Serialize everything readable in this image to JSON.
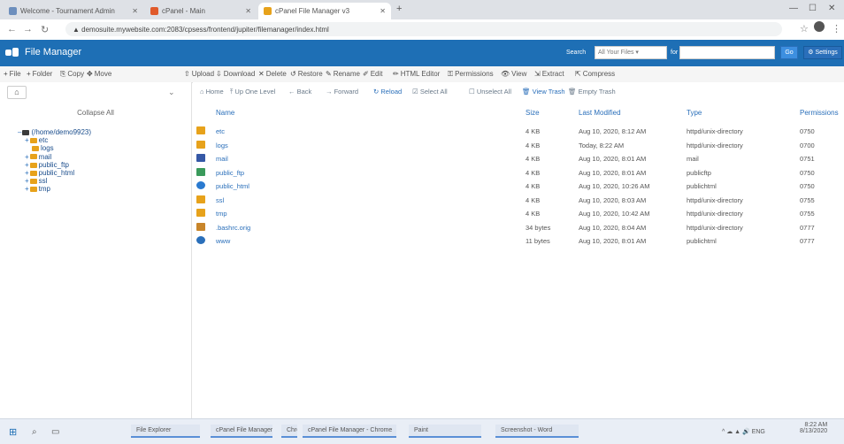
{
  "browser": {
    "tabs": [
      {
        "label": "Welcome - Tournament Admin",
        "color": "#6d8fbd"
      },
      {
        "label": "cPanel - Main",
        "color": "#e05a2b"
      },
      {
        "label": "cPanel File Manager v3",
        "color": "#e7a21b"
      }
    ],
    "new_tab": "+",
    "window_controls": {
      "minimize": "—",
      "maximize": "☐",
      "close": "✕"
    },
    "nav": {
      "back": "←",
      "forward": "→",
      "reload": "↻"
    },
    "url": "▲ demosuite.mywebsite.com:2083/cpsess/frontend/jupiter/filemanager/index.html",
    "star": "☆",
    "menu": "⋮"
  },
  "app": {
    "title": "File Manager",
    "logo_icon": "cpanel-logo-icon",
    "search_label": "Search",
    "search_scope": "All Your Files",
    "search_for_label": "for",
    "search_input": "",
    "go": "Go",
    "settings": "⚙ Settings"
  },
  "toolbar1": {
    "items": [
      {
        "icon": "+",
        "label": "File"
      },
      {
        "icon": "+",
        "label": "Folder"
      },
      {
        "icon": "⎘",
        "label": "Copy"
      },
      {
        "icon": "✥",
        "label": "Move"
      },
      {
        "icon": "⇧",
        "label": "Upload"
      },
      {
        "icon": "⇩",
        "label": "Download"
      },
      {
        "icon": "✕",
        "label": "Delete"
      },
      {
        "icon": "↺",
        "label": "Restore"
      },
      {
        "icon": "✎",
        "label": "Rename"
      },
      {
        "icon": "✐",
        "label": "Edit"
      },
      {
        "icon": "✏",
        "label": "HTML Editor"
      },
      {
        "icon": "⚿",
        "label": "Permissions"
      },
      {
        "icon": "👁",
        "label": "View"
      },
      {
        "icon": "⇲",
        "label": "Extract"
      },
      {
        "icon": "⇱",
        "label": "Compress"
      }
    ]
  },
  "sidebar": {
    "home_icon": "⌂",
    "chevron": "⌄",
    "collapse_all": "Collapse All",
    "tree": [
      {
        "label": "(/home/demo9923)",
        "level": 0,
        "prefix": "–",
        "home": true
      },
      {
        "label": "etc",
        "level": 1,
        "prefix": "+"
      },
      {
        "label": "logs",
        "level": 2,
        "prefix": ""
      },
      {
        "label": "mail",
        "level": 1,
        "prefix": "+"
      },
      {
        "label": "public_ftp",
        "level": 1,
        "prefix": "+"
      },
      {
        "label": "public_html",
        "level": 1,
        "prefix": "+"
      },
      {
        "label": "ssl",
        "level": 1,
        "prefix": "+"
      },
      {
        "label": "tmp",
        "level": 1,
        "prefix": "+"
      }
    ]
  },
  "toolbar2": {
    "items": [
      {
        "icon": "⌂",
        "label": "Home",
        "blue": false
      },
      {
        "icon": "⤒",
        "label": "Up One Level",
        "blue": false
      },
      {
        "icon": "←",
        "label": "Back",
        "blue": false
      },
      {
        "icon": "→",
        "label": "Forward",
        "blue": false
      },
      {
        "icon": "↻",
        "label": "Reload",
        "blue": true
      },
      {
        "icon": "☑",
        "label": "Select All",
        "blue": false
      },
      {
        "icon": "☐",
        "label": "Unselect All",
        "blue": false
      },
      {
        "icon": "🗑",
        "label": "View Trash",
        "blue": true
      },
      {
        "icon": "🗑",
        "label": "Empty Trash",
        "blue": false
      }
    ]
  },
  "table": {
    "columns": [
      "Name",
      "Size",
      "Last Modified",
      "Type",
      "Permissions"
    ],
    "rows": [
      {
        "name": "etc",
        "size": "4 KB",
        "modified": "Aug 10, 2020, 8:12 AM",
        "type": "httpd/unix-directory",
        "perms": "0750",
        "icon": "folder",
        "color": "#e7a21b"
      },
      {
        "name": "logs",
        "size": "4 KB",
        "modified": "Today, 8:22 AM",
        "type": "httpd/unix-directory",
        "perms": "0700",
        "icon": "folder",
        "color": "#e7a21b"
      },
      {
        "name": "mail",
        "size": "4 KB",
        "modified": "Aug 10, 2020, 8:01 AM",
        "type": "mail",
        "perms": "0751",
        "icon": "mail",
        "color": "#3558a6"
      },
      {
        "name": "public_ftp",
        "size": "4 KB",
        "modified": "Aug 10, 2020, 8:01 AM",
        "type": "publicftp",
        "perms": "0750",
        "icon": "ftp",
        "color": "#3a9a5b"
      },
      {
        "name": "public_html",
        "size": "4 KB",
        "modified": "Aug 10, 2020, 10:26 AM",
        "type": "publichtml",
        "perms": "0750",
        "icon": "web",
        "color": "#2a7ad0"
      },
      {
        "name": "ssl",
        "size": "4 KB",
        "modified": "Aug 10, 2020, 8:03 AM",
        "type": "httpd/unix-directory",
        "perms": "0755",
        "icon": "folder",
        "color": "#e7a21b"
      },
      {
        "name": "tmp",
        "size": "4 KB",
        "modified": "Aug 10, 2020, 10:42 AM",
        "type": "httpd/unix-directory",
        "perms": "0755",
        "icon": "folder",
        "color": "#e7a21b"
      },
      {
        "name": ".bashrc.orig",
        "size": "34 bytes",
        "modified": "Aug 10, 2020, 8:04 AM",
        "type": "httpd/unix-directory",
        "perms": "0777",
        "icon": "link",
        "color": "#c8852a"
      },
      {
        "name": "www",
        "size": "11 bytes",
        "modified": "Aug 10, 2020, 8:01 AM",
        "type": "publichtml",
        "perms": "0777",
        "icon": "search",
        "color": "#2a6fba"
      }
    ]
  },
  "taskbar": {
    "start": "⊞",
    "search": "⌕",
    "taskview": "▭",
    "items": [
      {
        "label": "File Explorer"
      },
      {
        "label": "cPanel File Manager"
      },
      {
        "label": "Chrome"
      },
      {
        "label": "cPanel File Manager - Chrome"
      },
      {
        "label": "Paint"
      },
      {
        "label": "Screenshot - Word"
      }
    ],
    "tray": "^ ☁ ▲ 🔊 ENG",
    "time": "8:22 AM",
    "date": "8/13/2020"
  }
}
